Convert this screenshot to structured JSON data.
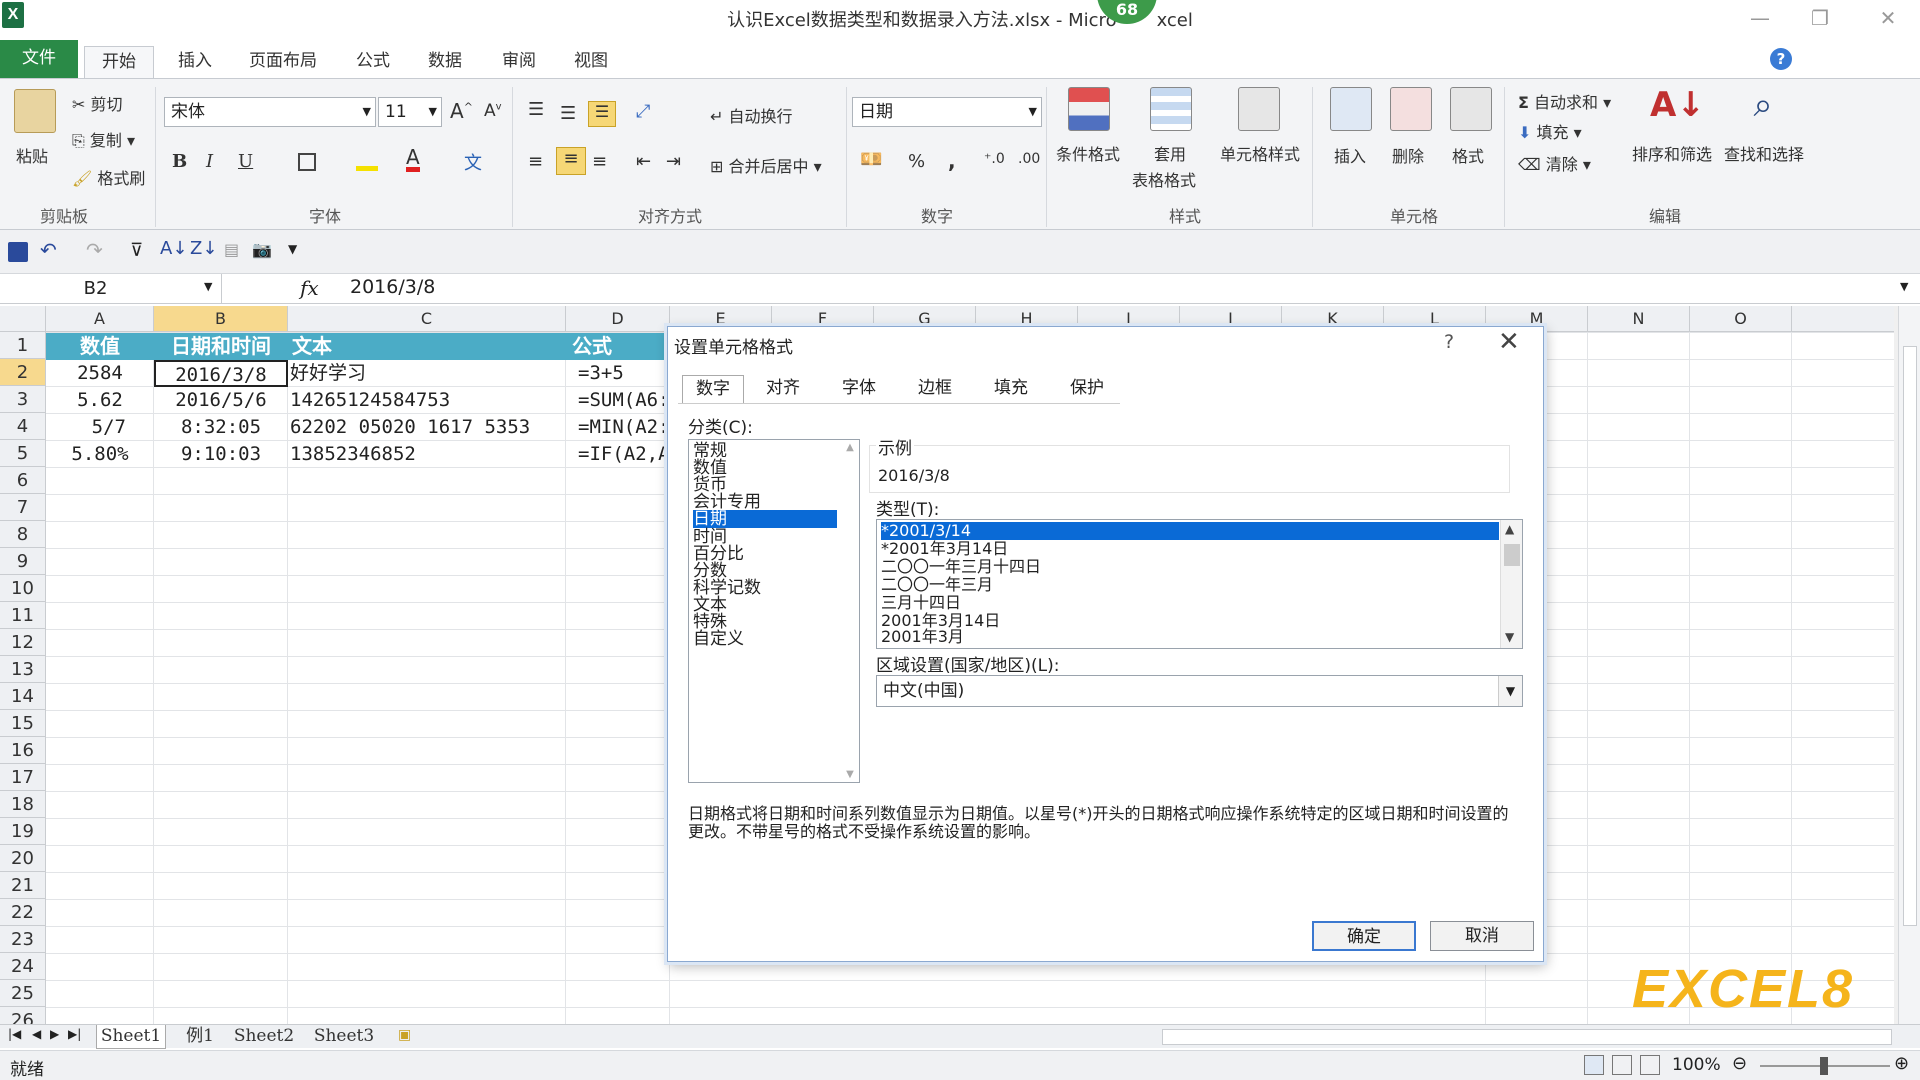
{
  "window": {
    "app_icon": "X",
    "title": "认识Excel数据类型和数据录入方法.xlsx - Micro",
    "title_suffix": "xcel",
    "badge": "68",
    "minimize": "—",
    "restore": "❐",
    "close": "✕"
  },
  "ribbon_tabs": [
    "文件",
    "开始",
    "插入",
    "页面布局",
    "公式",
    "数据",
    "审阅",
    "视图"
  ],
  "clipboard": {
    "paste": "粘贴",
    "cut": "剪切",
    "copy": "复制",
    "format_painter": "格式刷",
    "group": "剪贴板"
  },
  "font": {
    "name": "宋体",
    "size": "11",
    "bold": "B",
    "italic": "I",
    "underline": "U",
    "group": "字体"
  },
  "alignment": {
    "wrap": "自动换行",
    "merge": "合并后居中",
    "group": "对齐方式"
  },
  "number": {
    "format": "日期",
    "percent": "%",
    "comma": ",",
    "group": "数字"
  },
  "styles": {
    "conditional": "条件格式",
    "table_1": "套用",
    "table_2": "表格格式",
    "cell_styles": "单元格样式",
    "group": "样式"
  },
  "cells": {
    "insert": "插入",
    "delete": "删除",
    "format": "格式",
    "group": "单元格"
  },
  "editing": {
    "autosum": "自动求和",
    "fill": "填充",
    "clear": "清除",
    "sort": "排序和筛选",
    "find": "查找和选择",
    "group": "编辑"
  },
  "formula_bar": {
    "name_box": "B2",
    "fx": "fx",
    "value": "2016/3/8"
  },
  "columns": [
    "A",
    "B",
    "C",
    "D",
    "E",
    "F",
    "G",
    "H",
    "I",
    "J",
    "K",
    "L",
    "M",
    "N",
    "O"
  ],
  "rows": [
    "1",
    "2",
    "3",
    "4",
    "5",
    "6",
    "7",
    "8",
    "9",
    "10",
    "11",
    "12",
    "13",
    "14",
    "15",
    "16",
    "17",
    "18",
    "19",
    "20",
    "21",
    "22",
    "23",
    "24",
    "25",
    "26"
  ],
  "sheet": {
    "headers": [
      "数值",
      "日期和时间",
      "文本",
      "公式"
    ],
    "data": [
      [
        "2584",
        "2016/3/8",
        "好好学习",
        "=3+5"
      ],
      [
        "5.62",
        "2016/5/6",
        "14265124584753",
        "=SUM(A6:"
      ],
      [
        "5/7",
        "8:32:05",
        "62202 05020 1617 5353",
        "=MIN(A2:"
      ],
      [
        "5.80%",
        "9:10:03",
        "13852346852",
        "=IF(A2,A"
      ]
    ]
  },
  "sheet_tabs": [
    "Sheet1",
    "例1",
    "Sheet2",
    "Sheet3"
  ],
  "status": {
    "ready": "就绪",
    "zoom": "100%"
  },
  "dialog": {
    "title": "设置单元格格式",
    "help": "?",
    "close": "✕",
    "tabs": [
      "数字",
      "对齐",
      "字体",
      "边框",
      "填充",
      "保护"
    ],
    "category_label": "分类(C):",
    "categories": [
      "常规",
      "数值",
      "货币",
      "会计专用",
      "日期",
      "时间",
      "百分比",
      "分数",
      "科学记数",
      "文本",
      "特殊",
      "自定义"
    ],
    "selected_category": "日期",
    "sample_label": "示例",
    "sample_value": "2016/3/8",
    "type_label": "类型(T):",
    "types": [
      "*2001/3/14",
      "*2001年3月14日",
      "二〇〇一年三月十四日",
      "二〇〇一年三月",
      "三月十四日",
      "2001年3月14日",
      "2001年3月"
    ],
    "locale_label": "区域设置(国家/地区)(L):",
    "locale_value": "中文(中国)",
    "description": "日期格式将日期和时间系列数值显示为日期值。以星号(*)开头的日期格式响应操作系统特定的区域日期和时间设置的更改。不带星号的格式不受操作系统设置的影响。",
    "ok": "确定",
    "cancel": "取消"
  },
  "logo": "EXCEL8",
  "colors": {
    "file_tab": "#2a8a47",
    "header_fill": "#4bacc6",
    "selection": "#0a6ad6",
    "logo": "#f5b41b"
  }
}
